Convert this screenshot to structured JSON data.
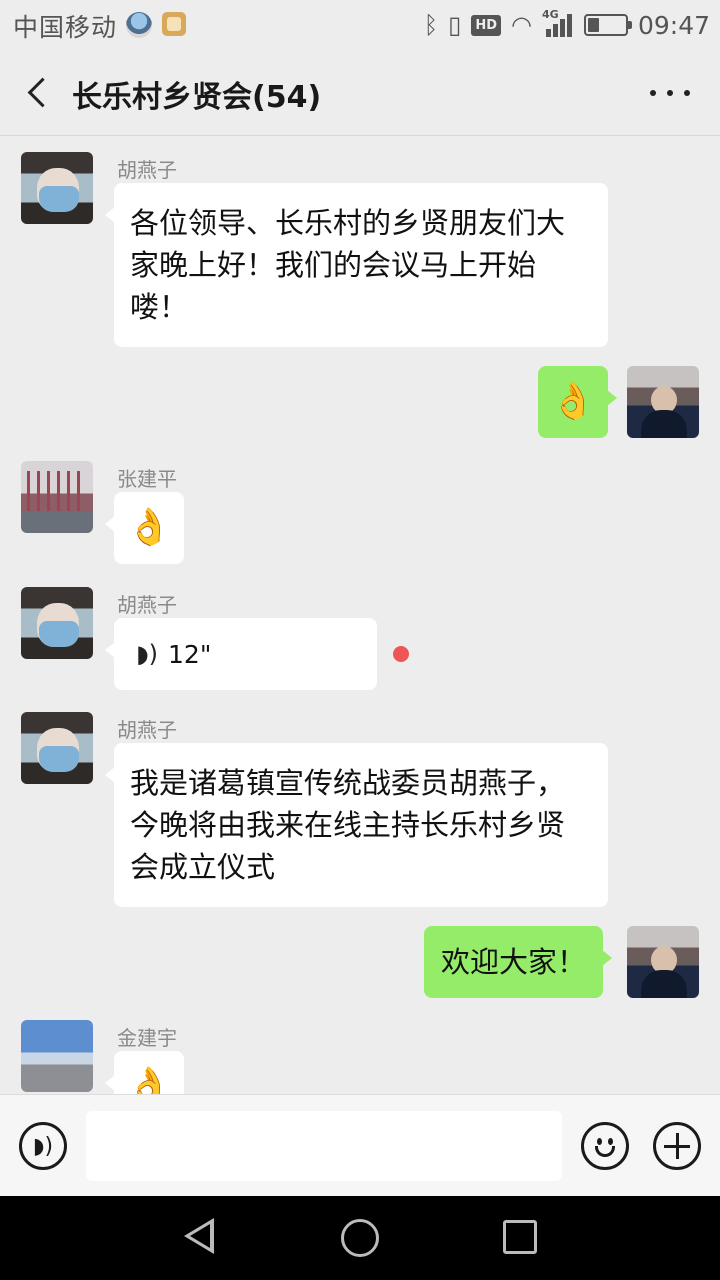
{
  "status_bar": {
    "carrier": "中国移动",
    "bluetooth_icon": "ᛒ",
    "vibrate_icon": "▯",
    "hd_label": "HD",
    "wifi_icon": "◠",
    "network_label": "4G",
    "time": "09:47",
    "battery_level": 0.3
  },
  "header": {
    "title": "长乐村乡贤会(54)"
  },
  "messages": [
    {
      "direction": "in",
      "sender": "胡燕子",
      "type": "text",
      "text": "各位领导、长乐村的乡贤朋友们大家晚上好！我们的会议马上开始喽！"
    },
    {
      "direction": "out",
      "type": "emoji",
      "emoji": "👌"
    },
    {
      "direction": "in",
      "sender": "张建平",
      "type": "emoji",
      "emoji": "👌"
    },
    {
      "direction": "in",
      "sender": "胡燕子",
      "type": "voice",
      "voice_icon": "◗)",
      "duration": "12\"",
      "unread": true
    },
    {
      "direction": "in",
      "sender": "胡燕子",
      "type": "text",
      "text": "我是诸葛镇宣传统战委员胡燕子，今晚将由我来在线主持长乐村乡贤会成立仪式"
    },
    {
      "direction": "out",
      "type": "text",
      "text": "欢迎大家！"
    },
    {
      "direction": "in",
      "sender": "金建宇",
      "type": "emoji",
      "emoji": "👌"
    }
  ],
  "input_bar": {
    "voice_icon": "◗)"
  },
  "colors": {
    "background": "#ededed",
    "out_bubble": "#95ec69",
    "in_bubble": "#ffffff",
    "unread_dot": "#f05555"
  },
  "icons": [
    "back-icon",
    "more-icon",
    "voice-input-icon",
    "emoji-icon",
    "plus-icon",
    "nav-back-icon",
    "nav-home-icon",
    "nav-recent-icon"
  ]
}
